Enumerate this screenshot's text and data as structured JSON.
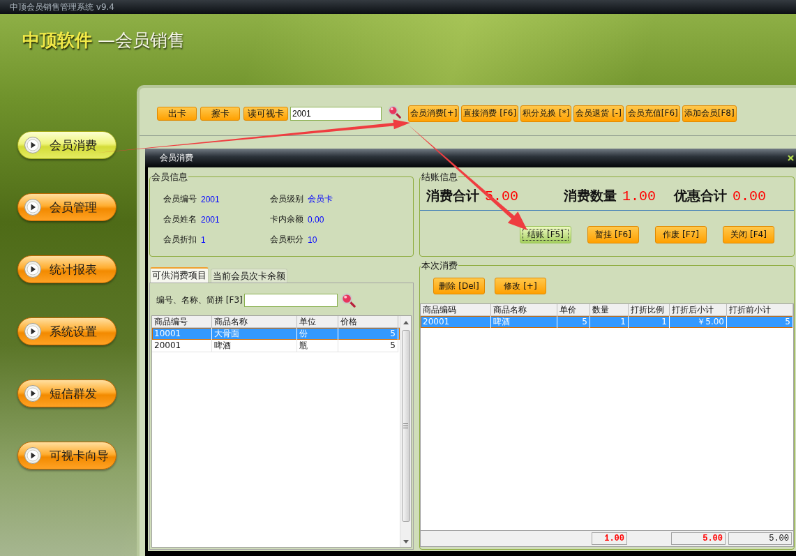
{
  "window": {
    "title": "中顶会员销售管理系统 v9.4"
  },
  "header": {
    "brand": "中顶软件",
    "subtitle": "—会员销售"
  },
  "sidebar": {
    "items": [
      {
        "label": "会员消费",
        "selected": true
      },
      {
        "label": "会员管理",
        "selected": false
      },
      {
        "label": "统计报表",
        "selected": false
      },
      {
        "label": "系统设置",
        "selected": false
      },
      {
        "label": "短信群发",
        "selected": false
      },
      {
        "label": "可视卡向导",
        "selected": false
      }
    ]
  },
  "toolbar": {
    "card_buttons": [
      "出卡",
      "擦卡",
      "读可视卡"
    ],
    "card_field": {
      "value": "2001"
    },
    "action_buttons": [
      "会员消费[+]",
      "直接消费 [F6]",
      "积分兑换 [*]",
      "会员退货 [-]",
      "会员充值[F6]",
      "添加会员[F8]"
    ]
  },
  "dialog": {
    "title": "会员消费",
    "member_info": {
      "title": "会员信息",
      "fields": [
        {
          "label": "会员编号",
          "value": "2001"
        },
        {
          "label": "会员级别",
          "value": "会员卡"
        },
        {
          "label": "会员姓名",
          "value": "2001"
        },
        {
          "label": "卡内余额",
          "value": "0.00"
        },
        {
          "label": "会员折扣",
          "value": "1"
        },
        {
          "label": "会员积分",
          "value": "10"
        }
      ]
    },
    "checkout": {
      "title": "结账信息",
      "totals": [
        {
          "label": "消费合计",
          "value": "5.00"
        },
        {
          "label": "消费数量",
          "value": "1.00"
        },
        {
          "label": "优惠合计",
          "value": "0.00"
        }
      ],
      "buttons": [
        {
          "label": "结账 [F5]",
          "focused": true
        },
        {
          "label": "暂挂 [F6]",
          "focused": false
        },
        {
          "label": "作废 [F7]",
          "focused": false
        },
        {
          "label": "关闭 [F4]",
          "focused": false
        }
      ]
    },
    "tabs": [
      {
        "label": "可供消费项目",
        "selected": true
      },
      {
        "label": "当前会员次卡余额",
        "selected": false
      }
    ],
    "item_search": {
      "label": "编号、名称、简拼 [F3]"
    },
    "items_table": {
      "columns": [
        {
          "label": "商品编号",
          "numeric": false
        },
        {
          "label": "商品名称",
          "numeric": false
        },
        {
          "label": "单位",
          "numeric": false
        },
        {
          "label": "价格",
          "numeric": true
        }
      ],
      "rows": [
        {
          "cells": [
            "10001",
            "大骨面",
            "份",
            "5"
          ],
          "selected": true
        },
        {
          "cells": [
            "20001",
            "啤酒",
            "瓶",
            "5"
          ],
          "selected": false
        }
      ]
    },
    "current_order": {
      "title": "本次消费",
      "buttons": [
        "删除 [Del]",
        "修改 [+]"
      ],
      "table": {
        "columns": [
          {
            "label": "商品编码",
            "numeric": false
          },
          {
            "label": "商品名称",
            "numeric": false
          },
          {
            "label": "单价",
            "numeric": true
          },
          {
            "label": "数量",
            "numeric": true
          },
          {
            "label": "打折比例",
            "numeric": true
          },
          {
            "label": "打折后小计",
            "numeric": true
          },
          {
            "label": "打折前小计",
            "numeric": true
          }
        ],
        "rows": [
          {
            "cells": [
              "20001",
              "啤酒",
              "5",
              "1",
              "1",
              "￥5.00",
              "5"
            ],
            "selected": true
          }
        ],
        "footer": [
          {
            "kind": "blank"
          },
          {
            "kind": "blank"
          },
          {
            "kind": "blank"
          },
          {
            "kind": "sum",
            "value": "1.00",
            "emphasis": true
          },
          {
            "kind": "blank"
          },
          {
            "kind": "sum",
            "value": "5.00",
            "emphasis": true
          },
          {
            "kind": "sum",
            "value": "5.00",
            "emphasis": false
          }
        ]
      }
    }
  }
}
